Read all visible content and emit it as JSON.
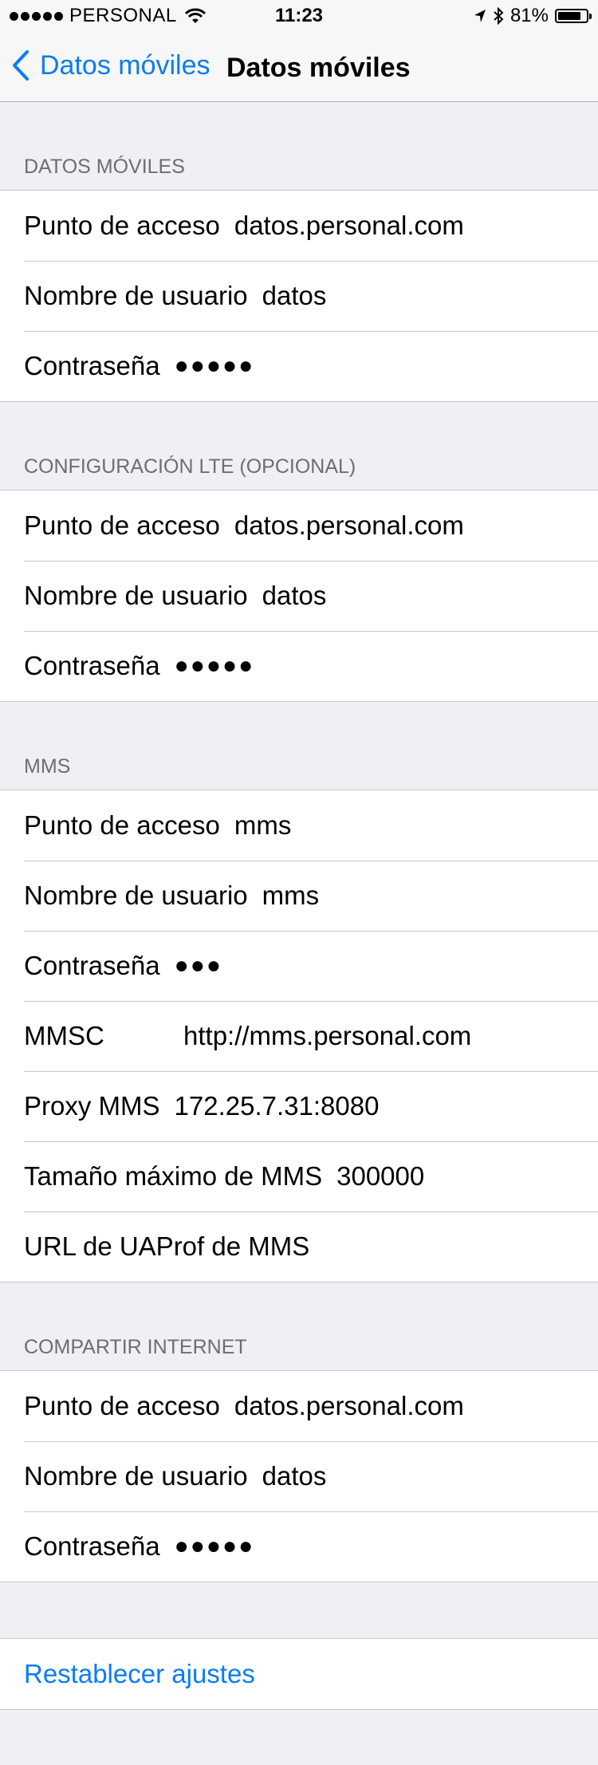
{
  "status": {
    "carrier": "PERSONAL",
    "time": "11:23",
    "battery": "81%",
    "battery_level": 0.81
  },
  "nav": {
    "back_label": "Datos móviles",
    "title": "Datos móviles"
  },
  "sections": {
    "datos": {
      "header": "DATOS MÓVILES",
      "apn_label": "Punto de acceso",
      "apn_value": "datos.personal.com",
      "user_label": "Nombre de usuario",
      "user_value": "datos",
      "pass_label": "Contraseña",
      "pass_value": "●●●●●"
    },
    "lte": {
      "header": "CONFIGURACIÓN LTE (OPCIONAL)",
      "apn_label": "Punto de acceso",
      "apn_value": "datos.personal.com",
      "user_label": "Nombre de usuario",
      "user_value": "datos",
      "pass_label": "Contraseña",
      "pass_value": "●●●●●"
    },
    "mms": {
      "header": "MMS",
      "apn_label": "Punto de acceso",
      "apn_value": "mms",
      "user_label": "Nombre de usuario",
      "user_value": "mms",
      "pass_label": "Contraseña",
      "pass_value": "●●●",
      "mmsc_label": "MMSC",
      "mmsc_value": "http://mms.personal.com",
      "proxy_label": "Proxy MMS",
      "proxy_value": "172.25.7.31:8080",
      "maxsize_label": "Tamaño máximo de MMS",
      "maxsize_value": "300000",
      "uaprof_label": "URL de UAProf de MMS",
      "uaprof_value": ""
    },
    "hotspot": {
      "header": "COMPARTIR INTERNET",
      "apn_label": "Punto de acceso",
      "apn_value": "datos.personal.com",
      "user_label": "Nombre de usuario",
      "user_value": "datos",
      "pass_label": "Contraseña",
      "pass_value": "●●●●●"
    }
  },
  "reset_label": "Restablecer ajustes",
  "colors": {
    "accent": "#0a7cf4",
    "background": "#efeff4"
  }
}
